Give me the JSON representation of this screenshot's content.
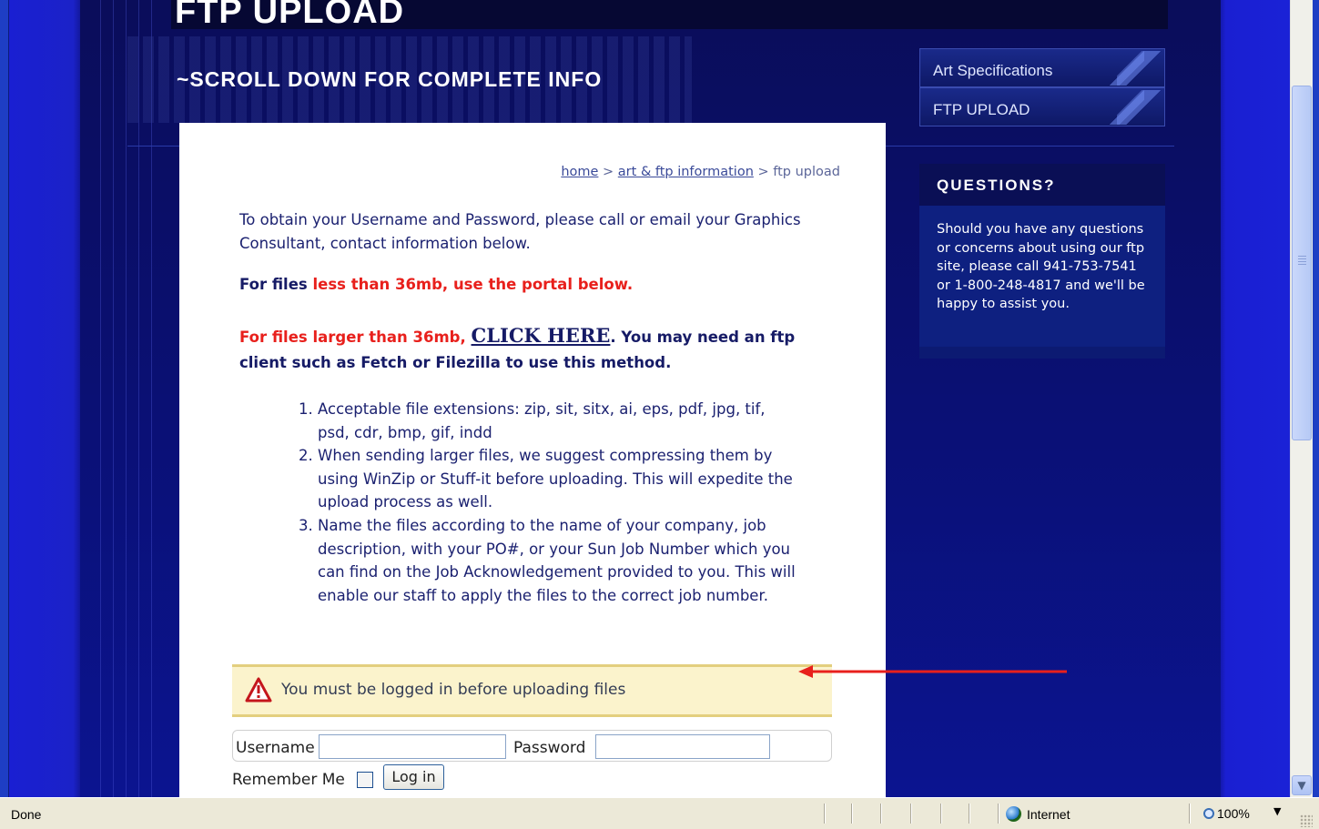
{
  "header": {
    "title": "FTP UPLOAD",
    "subtitle": "~SCROLL DOWN FOR COMPLETE INFO"
  },
  "nav": {
    "items": [
      {
        "label": "Art Specifications"
      },
      {
        "label": "FTP UPLOAD"
      }
    ]
  },
  "questions": {
    "heading": "QUESTIONS?",
    "body": "Should you have any questions or concerns about using our ftp site, please call 941-753-7541 or 1-800-248-4817 and we'll be happy to assist you."
  },
  "breadcrumb": {
    "home": "home",
    "sep1": ">",
    "art": "art & ftp information",
    "sep2": ">",
    "current": "ftp upload"
  },
  "content": {
    "intro": "To obtain your Username and Password, please call or email your Graphics Consultant, contact information below.",
    "small_prefix": "For files ",
    "small_red": "less than 36mb, use the portal below.",
    "large_red": "For files larger than 36mb, ",
    "click_here": "CLICK HERE",
    "large_rest": ". You may need an ftp client such as Fetch or Filezilla to use this method.",
    "rules": [
      "Acceptable file extensions: zip, sit, sitx, ai, eps, pdf, jpg, tif, psd, cdr, bmp, gif, indd",
      "When sending larger files, we suggest compressing them by using WinZip or Stuff-it before uploading. This will expedite the upload process as well.",
      "Name the files according to the name of your company, job description, with your PO#, or your Sun Job Number which you can find on the Job Acknowledgement provided to you. This will enable our staff to apply the files to the correct job number."
    ]
  },
  "notice": {
    "text": "You must be logged in before uploading files",
    "icon": "warning-icon"
  },
  "login": {
    "username_label": "Username",
    "username_value": "",
    "password_label": "Password",
    "password_value": "",
    "remember_label": "Remember Me",
    "remember_checked": false,
    "button_label": "Log in"
  },
  "statusbar": {
    "status": "Done",
    "zone": "Internet",
    "zoom": "100%"
  },
  "colors": {
    "background": "#0a0d6e",
    "accent_red": "#e8201c",
    "text_navy": "#1b2170",
    "notice_bg": "#fbf3cc"
  }
}
